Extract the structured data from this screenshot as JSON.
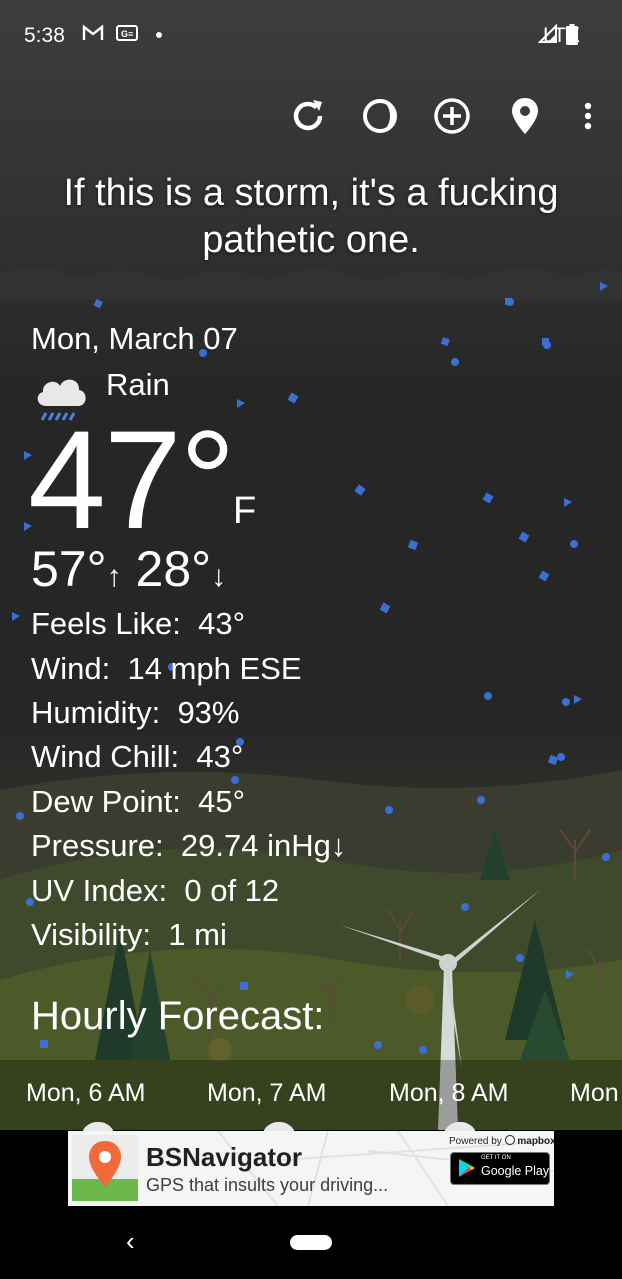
{
  "status_bar": {
    "time": "5:38",
    "icons": [
      "gmail-icon",
      "news-icon",
      "dot-icon"
    ],
    "network": "LTE",
    "right_icons": [
      "signal-icon",
      "battery-icon"
    ]
  },
  "toolbar": {
    "icons": [
      "refresh-icon",
      "moon-phase-icon",
      "add-location-icon",
      "location-pin-icon",
      "more-vert-icon"
    ]
  },
  "quote": "If this is a storm, it's a fucking pathetic one.",
  "current": {
    "date": "Mon, March 07",
    "condition": "Rain",
    "condition_icon": "rain-cloud-icon",
    "temperature": "47°",
    "unit": "F",
    "high": "57°",
    "low": "28°",
    "high_arrow": "↑",
    "low_arrow": "↓"
  },
  "details": [
    {
      "label": "Feels Like:",
      "value": "43°"
    },
    {
      "label": "Wind:",
      "value": "14 mph ESE"
    },
    {
      "label": "Humidity:",
      "value": "93%"
    },
    {
      "label": "Wind Chill:",
      "value": "43°"
    },
    {
      "label": "Dew Point:",
      "value": "45°"
    },
    {
      "label": "Pressure:",
      "value": "29.74 inHg↓"
    },
    {
      "label": "UV Index:",
      "value": "0 of 12"
    },
    {
      "label": "Visibility:",
      "value": "1 mi"
    }
  ],
  "hourly": {
    "title": "Hourly Forecast:",
    "items": [
      "Mon, 6 AM",
      "Mon, 7 AM",
      "Mon, 8 AM",
      "Mon"
    ]
  },
  "ad": {
    "title": "BSNavigator",
    "subtitle": "GPS that insults your driving...",
    "powered_by": "Powered by",
    "powered_brand": "mapbox",
    "store_small": "GET IT ON",
    "store_name": "Google Play"
  },
  "colors": {
    "accent_blue": "#3b6fd4",
    "ad_pin": "#f26a3b",
    "ad_ground": "#6bb84d"
  }
}
